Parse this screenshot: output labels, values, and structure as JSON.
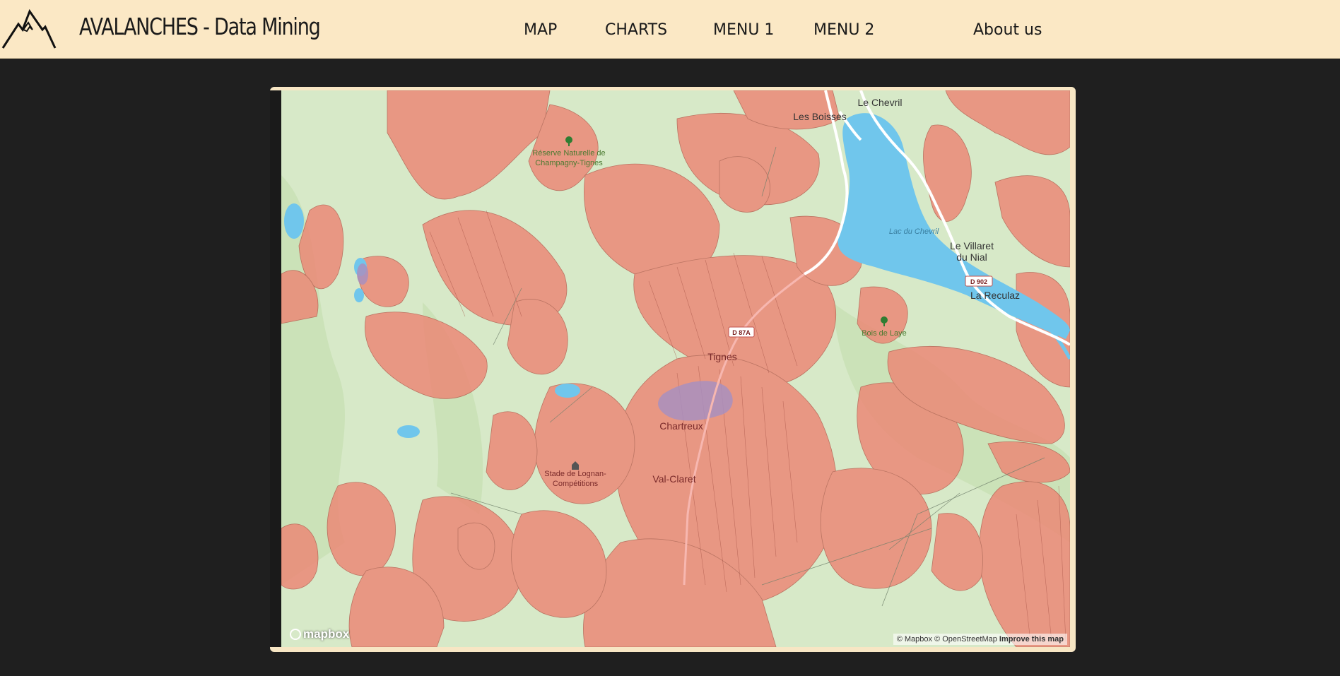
{
  "header": {
    "brand": "AVALANCHES - Data Mining",
    "nav": [
      "MAP",
      "CHARTS",
      "MENU 1",
      "MENU 2",
      "About us"
    ]
  },
  "map": {
    "labels": {
      "reserve_1": "Réserve Naturelle de",
      "reserve_2": "Champagny-Tignes",
      "les_boisses": "Les Boisses",
      "le_chevril": "Le Chevril",
      "lac_du_chevril": "Lac du Chevril",
      "le_villaret_1": "Le Villaret",
      "le_villaret_2": "du Nial",
      "d902": "D 902",
      "la_reculaz": "La Reculaz",
      "d87a": "D 87A",
      "bois_de_laye": "Bois de Laye",
      "tignes": "Tignes",
      "chartreux": "Chartreux",
      "stade_1": "Stade de Lognan-",
      "stade_2": "Compétitions",
      "val_claret": "Val-Claret"
    },
    "colors": {
      "terrain": "#d7e9c8",
      "avalanche_zone": "#ec8674",
      "water": "#70c6ec",
      "road": "#ffffff",
      "frame": "#f7e6c4",
      "header": "#fbe8c5"
    },
    "logo": "mapbox",
    "attribution": "© Mapbox © OpenStreetMap",
    "improve": "Improve this map"
  }
}
